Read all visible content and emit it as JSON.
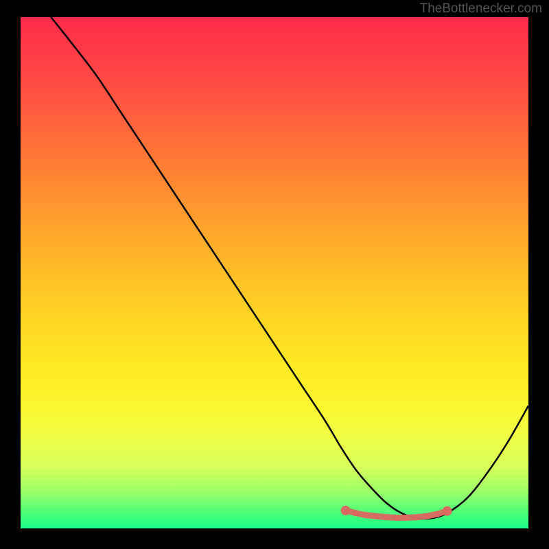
{
  "watermark": "TheBottlenecker.com",
  "chart_data": {
    "type": "line",
    "title": "",
    "xlabel": "",
    "ylabel": "",
    "xlim": [
      0,
      100
    ],
    "ylim": [
      0,
      100
    ],
    "series": [
      {
        "name": "curve",
        "x": [
          6,
          10,
          15,
          20,
          25,
          30,
          35,
          40,
          45,
          50,
          55,
          60,
          63,
          66,
          69,
          72,
          75,
          78,
          81,
          84,
          88,
          92,
          96,
          100
        ],
        "y": [
          100,
          95,
          88.5,
          81,
          73.5,
          66,
          58.5,
          51,
          43.5,
          36,
          28.5,
          21,
          16,
          11.5,
          8,
          5,
          3,
          2,
          2,
          3,
          6,
          11,
          17,
          24
        ]
      },
      {
        "name": "markers",
        "x": [
          64,
          66,
          68,
          70,
          72,
          74,
          76,
          78,
          80,
          82,
          84
        ],
        "y": [
          3.5,
          3.0,
          2.6,
          2.4,
          2.2,
          2.1,
          2.1,
          2.2,
          2.4,
          2.8,
          3.4
        ]
      }
    ]
  },
  "colors": {
    "curve": "#000000",
    "marker": "#d86a62"
  }
}
